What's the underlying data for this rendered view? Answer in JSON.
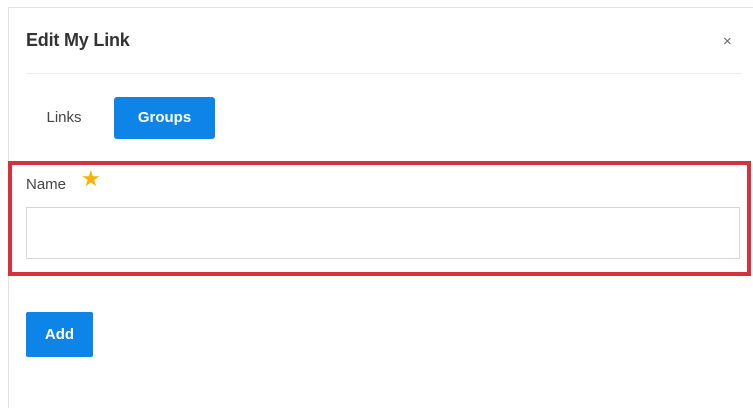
{
  "dialog": {
    "title": "Edit My Link",
    "close_label": "×"
  },
  "tabs": [
    {
      "label": "Links",
      "active": false
    },
    {
      "label": "Groups",
      "active": true
    }
  ],
  "form": {
    "name_label": "Name",
    "required_marker": "★",
    "name_value": "",
    "name_placeholder": ""
  },
  "actions": {
    "add_label": "Add"
  },
  "colors": {
    "accent": "#0d84e8",
    "highlight": "#d8303c",
    "required_star": "#f5b400"
  }
}
